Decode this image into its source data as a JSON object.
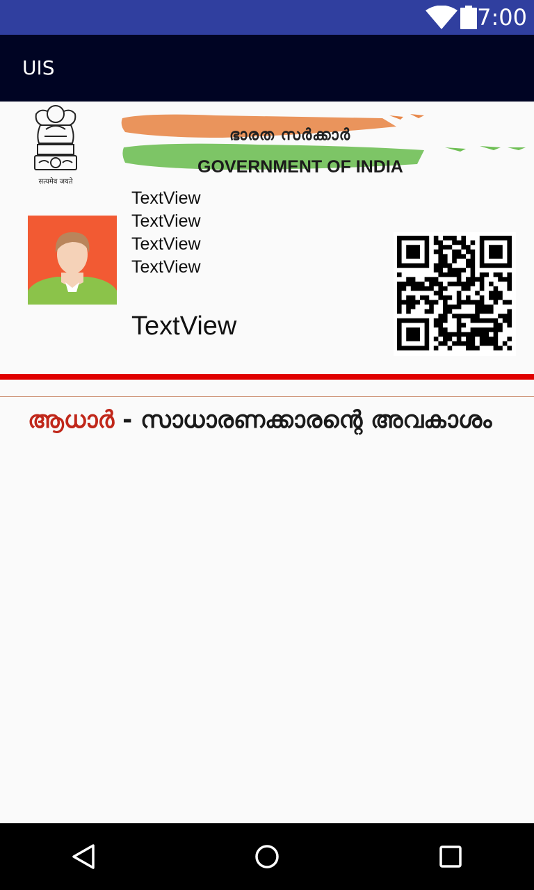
{
  "status_bar": {
    "time": "7:00",
    "icons": [
      "wifi-icon",
      "battery-icon"
    ],
    "background": "#303f9f"
  },
  "app_bar": {
    "title": "UIS",
    "background": "#000423"
  },
  "card": {
    "emblem_icon": "national-emblem-icon",
    "emblem_caption": "सत्यमेव जयते",
    "banner_malayalam": "ഭാരത സർക്കാർ",
    "banner_english": "GOVERNMENT OF INDIA",
    "photo_icon": "user-avatar-icon",
    "text_views": [
      "TextView",
      "TextView",
      "TextView",
      "TextView"
    ],
    "text_view_large": "TextView",
    "qr_icon": "qr-code-icon"
  },
  "slogan": {
    "part1": "ആധാർ",
    "separator": " - ",
    "part2": "സാധാരണക്കാരന്റെ അവകാശം",
    "accent_color": "#c0271a"
  },
  "nav_bar": {
    "icons": [
      "back-icon",
      "home-icon",
      "recents-icon"
    ]
  }
}
